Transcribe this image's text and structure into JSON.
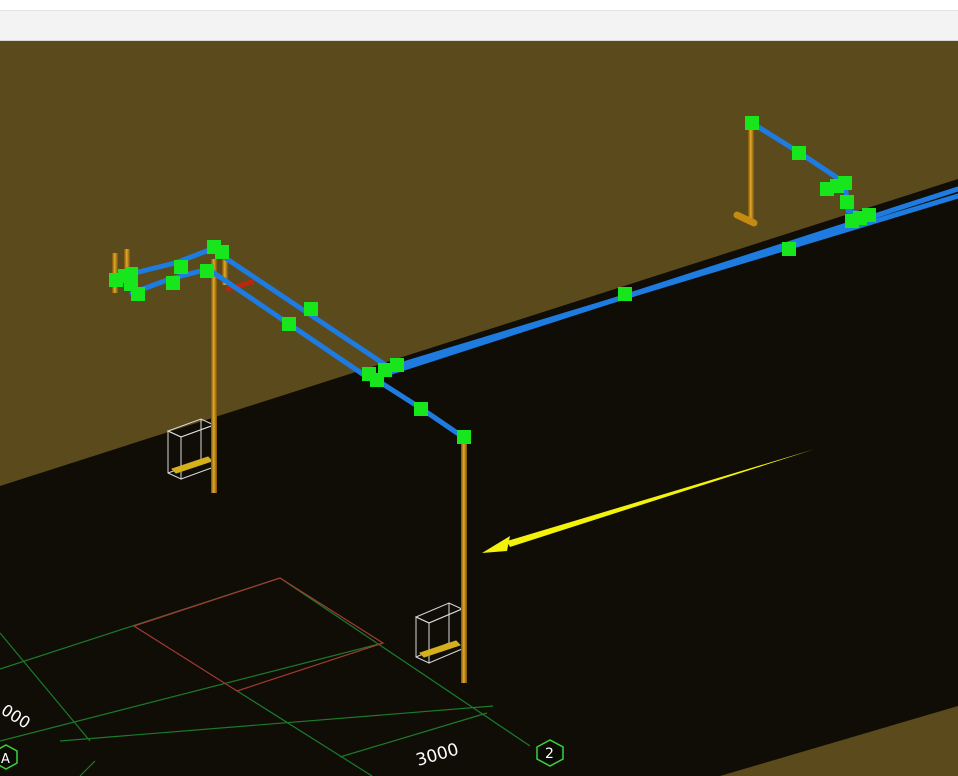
{
  "colors": {
    "upper_background": "#5b4a1b",
    "lower_background": "#100d07",
    "pipe_blue": "#1e7be0",
    "pipe_orange": "#c48a12",
    "node_green": "#16e61b",
    "grid_green": "#1c7a2b",
    "grid_red": "#a33a32",
    "arrow_yellow": "#f2f20a",
    "fixture_outline": "#d9d9d9"
  },
  "icons": {
    "pipe_node": "green-square-node-icon",
    "annotation_arrow": "yellow-arrow-icon",
    "fixture": "wireframe-box-icon"
  },
  "dimensions": {
    "left_dimension": "000",
    "bottom_dimension": "3000"
  },
  "grid_tags": {
    "left": "A",
    "right": "2"
  }
}
